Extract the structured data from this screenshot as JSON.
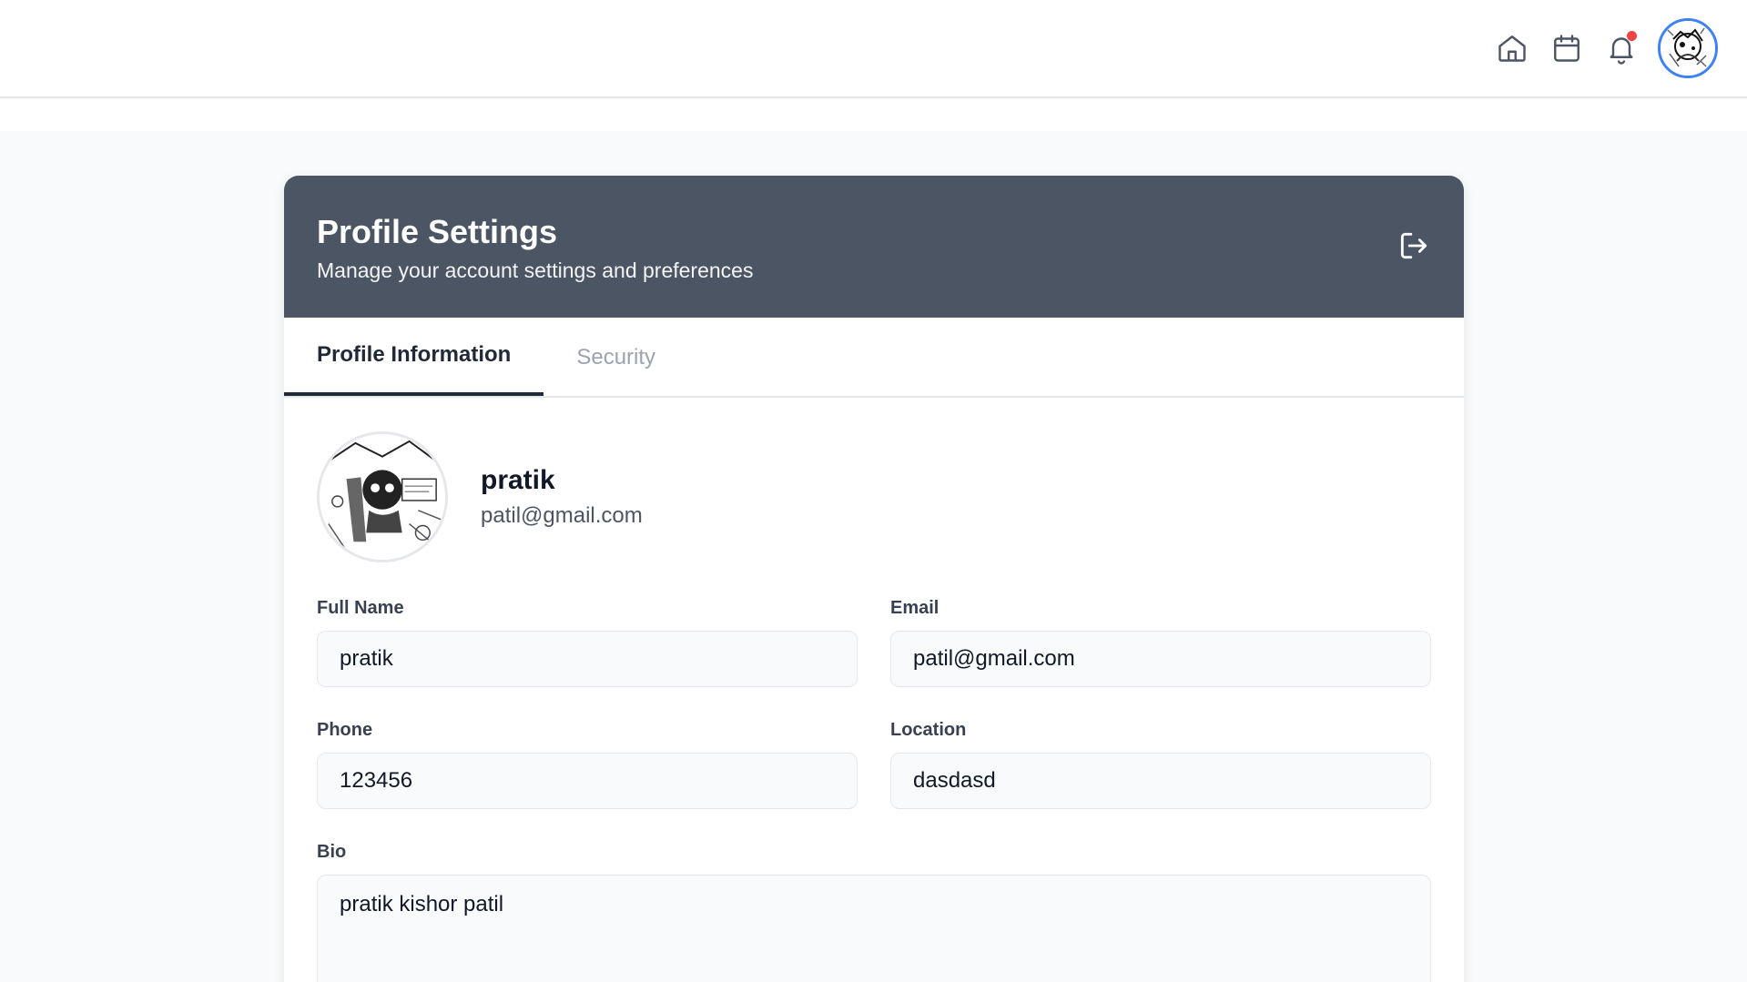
{
  "nav": {
    "icons": [
      "home-icon",
      "calendar-icon",
      "bell-icon"
    ],
    "notification_dot_color": "#ef4444",
    "avatar_ring_color": "#3b82f6"
  },
  "header": {
    "title": "Profile Settings",
    "subtitle": "Manage your account settings and preferences",
    "background": "#4b5563",
    "logout_icon": "logout-icon"
  },
  "tabs": [
    {
      "label": "Profile Information",
      "active": true
    },
    {
      "label": "Security",
      "active": false
    }
  ],
  "profile": {
    "name": "pratik",
    "email": "patil@gmail.com"
  },
  "form": {
    "full_name": {
      "label": "Full Name",
      "value": "pratik"
    },
    "email": {
      "label": "Email",
      "value": "patil@gmail.com"
    },
    "phone": {
      "label": "Phone",
      "value": "123456"
    },
    "location": {
      "label": "Location",
      "value": "dasdasd"
    },
    "bio": {
      "label": "Bio",
      "value": "pratik kishor patil"
    }
  }
}
